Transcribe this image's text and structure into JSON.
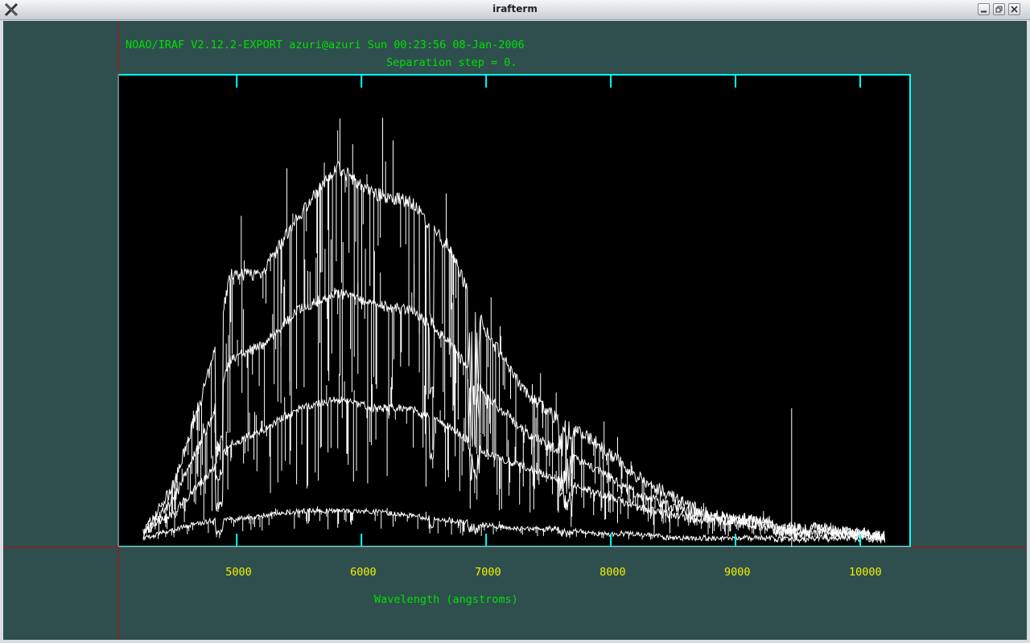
{
  "window": {
    "title": "irafterm"
  },
  "window_buttons": {
    "minimize": "_",
    "maximize": "□",
    "close": "×"
  },
  "plot": {
    "header": "NOAO/IRAF V2.12.2-EXPORT azuri@azuri Sun 00:23:56 08-Jan-2006",
    "subtitle": "Separation step = 0.",
    "xlabel": "Wavelength (angstroms)",
    "x_ticks": [
      "5000",
      "6000",
      "7000",
      "8000",
      "9000",
      "10000"
    ],
    "colors": {
      "background": "#2f4f4f",
      "frame": "#00ffff",
      "text": "#00e000",
      "ticklabel": "#f0f000",
      "spectrum": "#ffffff",
      "cursor": "#cc0000",
      "plot_bg": "#000000"
    }
  },
  "chart_data": {
    "type": "line",
    "title": "Separation step = 0.",
    "xlabel": "Wavelength (angstroms)",
    "ylabel": "",
    "xlim": [
      4050,
      10400
    ],
    "x_ticks": [
      5000,
      6000,
      7000,
      8000,
      9000,
      10000
    ],
    "series": [
      {
        "x": [
          4250,
          4500,
          4800,
          4950,
          5200,
          5500,
          5800,
          6100,
          6400,
          6700,
          7000,
          7300,
          7600,
          7900,
          8200,
          8500,
          8800,
          9100,
          9400,
          9700,
          10000,
          10200
        ],
        "values": [
          0.02,
          0.13,
          0.4,
          0.6,
          0.6,
          0.73,
          0.84,
          0.78,
          0.76,
          0.66,
          0.47,
          0.34,
          0.27,
          0.22,
          0.15,
          0.1,
          0.06,
          0.05,
          0.04,
          0.03,
          0.02,
          0.01
        ]
      },
      {
        "x": [
          4250,
          4500,
          4800,
          4950,
          5200,
          5500,
          5800,
          6100,
          6400,
          6700,
          7000,
          7300,
          7600,
          7900,
          8200,
          8500,
          8800,
          9100,
          9400,
          9700,
          10000,
          10200
        ],
        "values": [
          0.02,
          0.1,
          0.28,
          0.41,
          0.44,
          0.52,
          0.56,
          0.53,
          0.52,
          0.45,
          0.33,
          0.25,
          0.2,
          0.16,
          0.11,
          0.08,
          0.06,
          0.05,
          0.04,
          0.03,
          0.02,
          0.01
        ]
      },
      {
        "x": [
          4250,
          4500,
          4800,
          4950,
          5200,
          5500,
          5800,
          6100,
          6400,
          6700,
          7000,
          7300,
          7600,
          7900,
          8200,
          8500,
          8800,
          9100,
          9400,
          9700,
          10000,
          10200
        ],
        "values": [
          0.02,
          0.07,
          0.16,
          0.22,
          0.25,
          0.3,
          0.32,
          0.3,
          0.3,
          0.26,
          0.2,
          0.17,
          0.14,
          0.11,
          0.08,
          0.06,
          0.05,
          0.04,
          0.03,
          0.02,
          0.02,
          0.01
        ]
      },
      {
        "x": [
          4250,
          4500,
          4800,
          4950,
          5200,
          5500,
          5800,
          6100,
          6400,
          6700,
          7000,
          7300,
          7600,
          7900,
          8200,
          8500,
          8800,
          9100,
          9400,
          9700,
          10000,
          10200
        ],
        "values": [
          0.01,
          0.03,
          0.05,
          0.05,
          0.06,
          0.07,
          0.07,
          0.07,
          0.06,
          0.05,
          0.04,
          0.03,
          0.03,
          0.02,
          0.02,
          0.01,
          0.01,
          0.01,
          0.01,
          0.01,
          0.01,
          0.01
        ]
      }
    ]
  }
}
